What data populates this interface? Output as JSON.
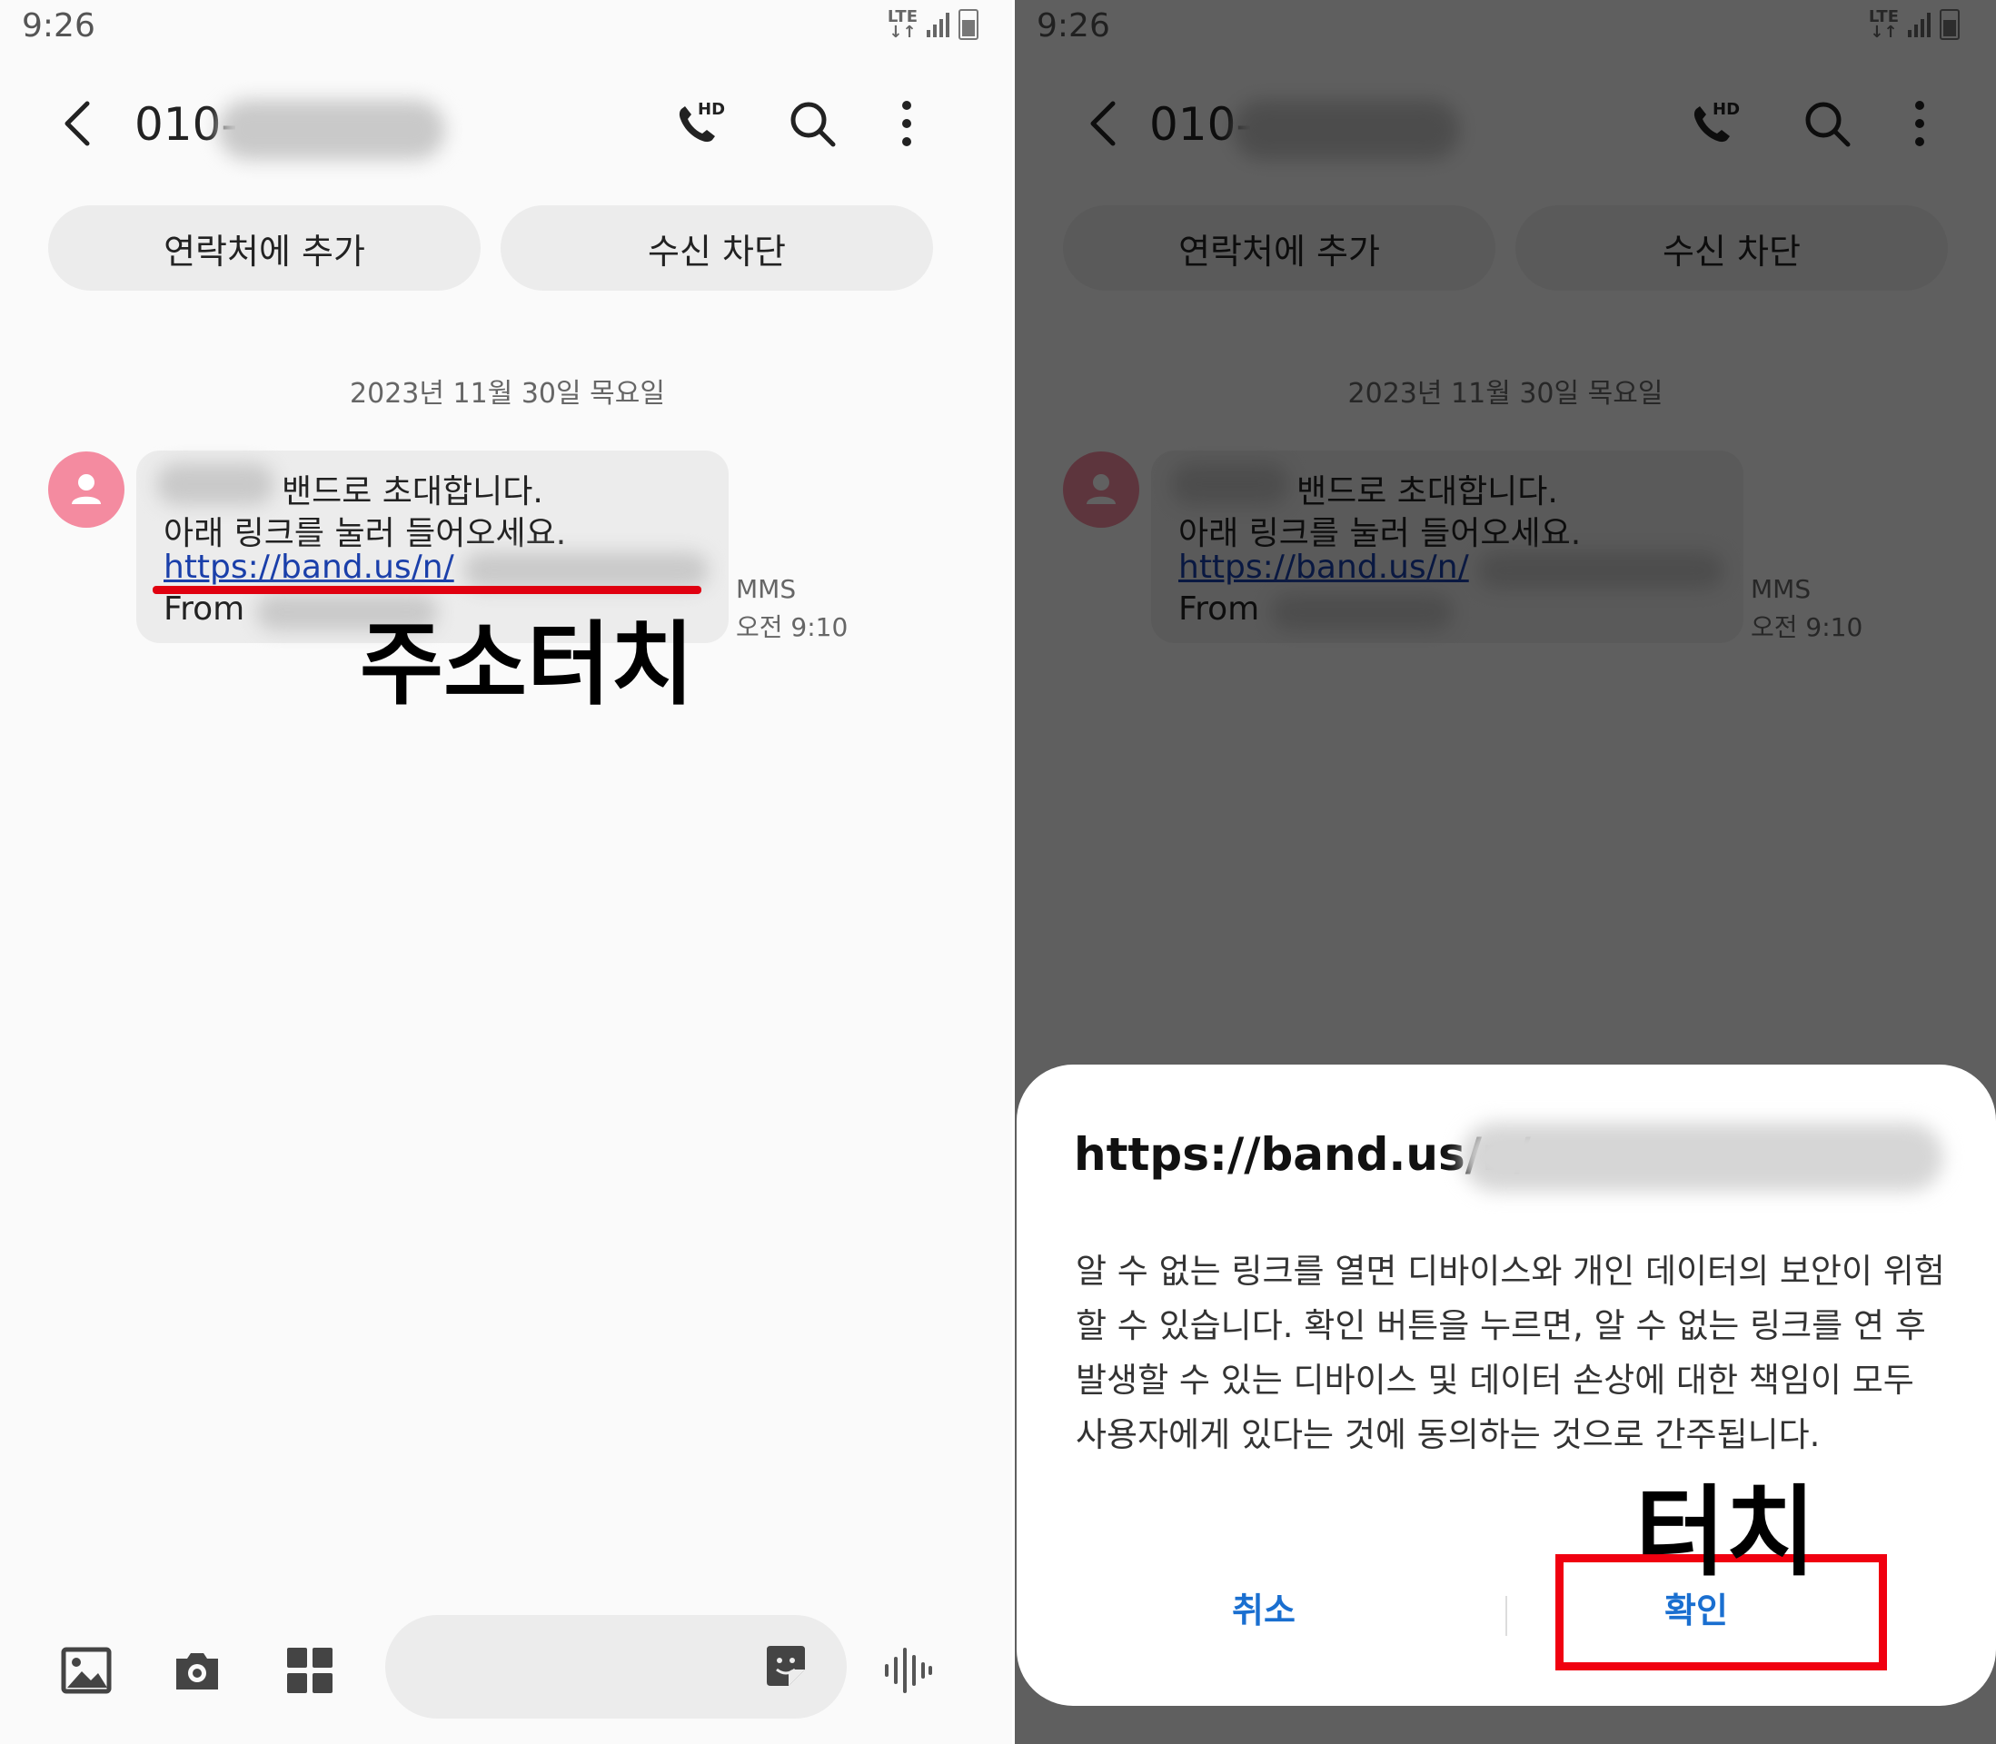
{
  "status": {
    "time": "9:26",
    "network": "LTE"
  },
  "thread": {
    "number_prefix": "010-"
  },
  "chips": {
    "add_contact": "연락처에 추가",
    "block": "수신 차단"
  },
  "date_header": "2023년 11월 30일 목요일",
  "message": {
    "line1": "밴드로 초대합니다.",
    "line2": "아래 링크를 눌러 들어오세요.",
    "link": "https://band.us/n/",
    "from": "From",
    "type": "MMS",
    "time": "오전 9:10"
  },
  "annotations": {
    "tap_address": "주소터치",
    "tap": "터치"
  },
  "dialog": {
    "url": "https://band.us/n/",
    "body": "알 수 없는 링크를 열면 디바이스와 개인 데이터의 보안이 위험할 수 있습니다. 확인 버튼을 누르면, 알 수 없는 링크를 연 후 발생할 수 있는 디바이스 및 데이터 손상에 대한 책임이 모두 사용자에게 있다는 것에 동의하는 것으로 간주됩니다.",
    "cancel": "취소",
    "confirm": "확인"
  },
  "colors": {
    "link": "#1a3faa",
    "accent_red": "#f00010",
    "dialog_button": "#1a6fd0",
    "avatar": "#f48ba0"
  },
  "icons": [
    "back-icon",
    "hd-call-icon",
    "search-icon",
    "more-icon",
    "gallery-icon",
    "camera-icon",
    "apps-icon",
    "sticker-icon",
    "voice-icon"
  ]
}
